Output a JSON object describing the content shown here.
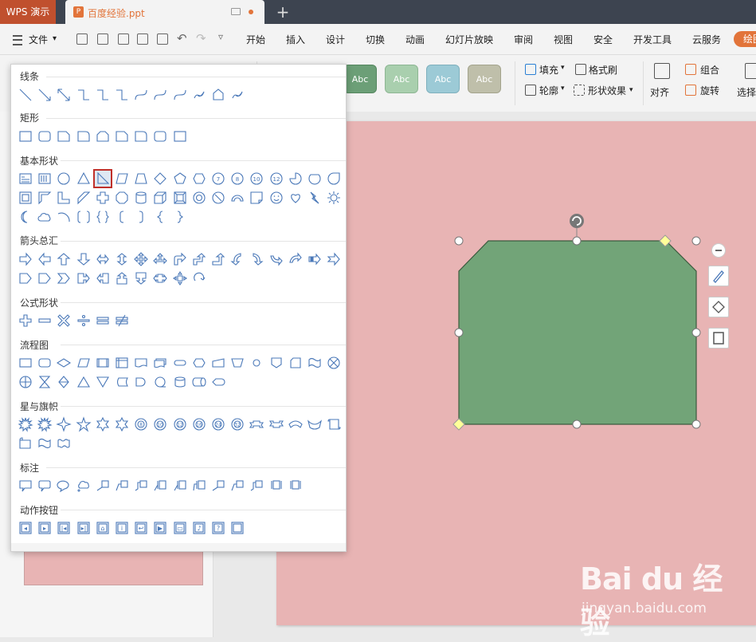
{
  "titlebar": {
    "app_tab": "WPS 演示",
    "doc_tab": "百度经验.ppt",
    "doc_icon": "P",
    "new_tab_label": "+"
  },
  "menubar": {
    "file_label": "文件",
    "items": [
      "开始",
      "插入",
      "设计",
      "切换",
      "动画",
      "幻灯片放映",
      "审阅",
      "视图",
      "安全",
      "开发工具",
      "云服务"
    ],
    "cloud_badge": "绘图"
  },
  "ribbon": {
    "style_swatches": [
      {
        "label": "Abc",
        "color": "#6c9f77",
        "border": "#55875f"
      },
      {
        "label": "Abc",
        "color": "#a9cfae",
        "border": "#8db693"
      },
      {
        "label": "Abc",
        "color": "#9ccad6",
        "border": "#7fb0bd"
      },
      {
        "label": "Abc",
        "color": "#bfbfaa",
        "border": "#a3a38c"
      }
    ],
    "fill_label": "填充",
    "format_brush_label": "格式刷",
    "outline_label": "轮廓",
    "shape_effect_label": "形状效果",
    "align_label": "对齐",
    "group_label": "组合",
    "rotate_label": "旋转",
    "select_label": "选择"
  },
  "gallery": {
    "categories": [
      {
        "key": "lines",
        "label": "线条"
      },
      {
        "key": "rectangles",
        "label": "矩形"
      },
      {
        "key": "basic",
        "label": "基本形状"
      },
      {
        "key": "arrows",
        "label": "箭头总汇"
      },
      {
        "key": "equation",
        "label": "公式形状"
      },
      {
        "key": "flowchart",
        "label": "流程图"
      },
      {
        "key": "stars",
        "label": "星与旗帜"
      },
      {
        "key": "callouts",
        "label": "标注"
      },
      {
        "key": "action",
        "label": "动作按钮"
      }
    ],
    "selected_shape": "right-triangle",
    "basic_shape_labels": [
      "7",
      "8",
      "10",
      "12"
    ],
    "equation_labels": [
      "+",
      "−",
      "×",
      "÷",
      "=",
      "≠"
    ]
  },
  "canvas": {
    "slide_color": "#e8b4b4",
    "shape_fill": "#72a478",
    "shape_stroke": "#3b5a3e",
    "selection_handle_color": "#ffffff",
    "adjust_handle_color": "#ffff99"
  },
  "watermark": {
    "logo_text": "Bai du 经验",
    "url": "jingyan.baidu.com"
  }
}
